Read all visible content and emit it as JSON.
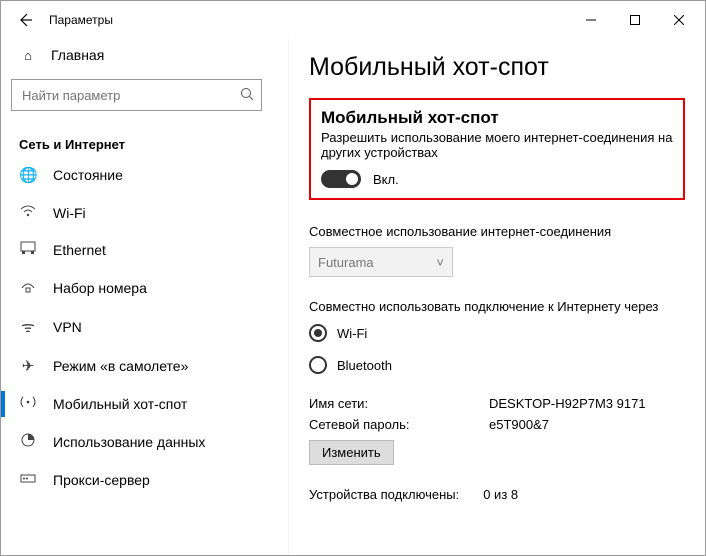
{
  "window": {
    "title": "Параметры"
  },
  "sidebar": {
    "home_label": "Главная",
    "search_placeholder": "Найти параметр",
    "category": "Сеть и Интернет",
    "items": [
      {
        "label": "Состояние"
      },
      {
        "label": "Wi-Fi"
      },
      {
        "label": "Ethernet"
      },
      {
        "label": "Набор номера"
      },
      {
        "label": "VPN"
      },
      {
        "label": "Режим «в самолете»"
      },
      {
        "label": "Мобильный хот-спот"
      },
      {
        "label": "Использование данных"
      },
      {
        "label": "Прокси-сервер"
      }
    ]
  },
  "page": {
    "title": "Мобильный хот-спот",
    "hotspot": {
      "title": "Мобильный хот-спот",
      "desc": "Разрешить использование моего интернет-соединения на других устройствах",
      "state": "Вкл."
    },
    "share": {
      "label": "Совместное использование интернет-соединения",
      "value": "Futurama"
    },
    "via": {
      "label": "Совместно использовать подключение к Интернету через",
      "wifi": "Wi-Fi",
      "bt": "Bluetooth"
    },
    "net": {
      "name_label": "Имя сети:",
      "name_value": "DESKTOP-H92P7M3 9171",
      "pwd_label": "Сетевой пароль:",
      "pwd_value": "e5T900&7",
      "change_btn": "Изменить"
    },
    "devices": {
      "label": "Устройства подключены:",
      "value": "0 из 8"
    }
  }
}
